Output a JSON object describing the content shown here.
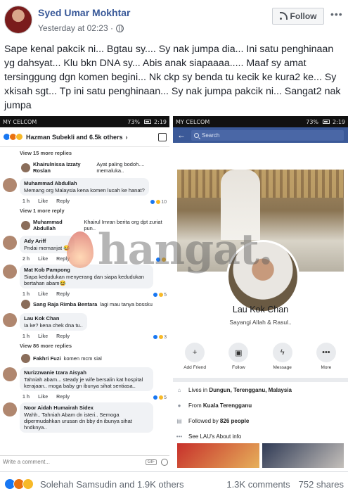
{
  "post": {
    "author": "Syed Umar Mokhtar",
    "time": "Yesterday at 02:23 · ",
    "follow_label": "Follow",
    "text": "Sape kenal pakcik ni... Bgtau sy.... Sy nak jumpa dia... Ini satu penghinaan yg dahsyat... Klu bkn DNA sy... Abis anak siapaaaa..... Maaf sy amat tersinggung dgn komen begini... Nk ckp sy benda tu kecik ke kura2 ke... Sy xkisah sgt... Tp ini satu penghinaan... Sy nak jumpa pakcik ni... Sangat2 nak jumpa"
  },
  "left_screen": {
    "carrier": "MY CELCOM",
    "battery": "73%",
    "clock": "2:19",
    "reacted_by": "Hazman Subekli and 6.5k others",
    "items": [
      {
        "kind": "more",
        "text": "View 15 more replies"
      },
      {
        "kind": "reply",
        "name": "Khairulnissa Izzaty Roslan",
        "text": "Ayat paling bodoh.... memaluka.."
      },
      {
        "kind": "comment",
        "name": "Muhammad Abdullah",
        "text": "Memang org Malaysia kena komen lucah ke hanat?",
        "time": "1 h",
        "count": "10"
      },
      {
        "kind": "more",
        "text": "View 1 more reply"
      },
      {
        "kind": "reply",
        "name": "Muhammad Abdullah",
        "text": "Khairul Imran berita org dpt zuriat pun.."
      },
      {
        "kind": "comment",
        "name": "Ady Ariff",
        "text": "Pndai memanjat 😂",
        "time": "2 h",
        "count": ""
      },
      {
        "kind": "comment",
        "name": "Mat Kob Pampong",
        "text": "Siapa kedudukan menyerang dan siapa kedudukan bertahan abam😂",
        "time": "1 h",
        "count": "5"
      },
      {
        "kind": "reply",
        "name": "Sang Raja Rimba Bentara",
        "text": "lagi mau tanya bossku"
      },
      {
        "kind": "comment",
        "name": "Lau Kok Chan",
        "text": "Ia ke? kena chek dna tu..",
        "time": "1 h",
        "count": "3"
      },
      {
        "kind": "more",
        "text": "View 86 more replies"
      },
      {
        "kind": "reply",
        "name": "Fakhri Fuzi",
        "text": "komen mcm sial"
      },
      {
        "kind": "comment",
        "name": "Nurizzwanie Izara Aisyah",
        "text": "Tahniah abam... steady je wife bersalin kat hospital kerajaan.. moga baby gn ibunya sihat sentiasa..",
        "time": "1 h",
        "count": "5"
      },
      {
        "kind": "comment",
        "name": "Noor Aidah Humairah Sidex",
        "text": "Wahh.. Tahniah Abam dn isteri.. Semoga dipermudahkan urusan dn bby dn ibunya sihat hndknya..",
        "time": "",
        "count": ""
      }
    ],
    "labels": {
      "like": "Like",
      "reply": "Reply",
      "write": "Write a comment...",
      "gif": "GIF"
    }
  },
  "right_screen": {
    "carrier": "MY CELCOM",
    "battery": "73%",
    "clock": "2:19",
    "search_placeholder": "Search",
    "profile_name": "Lau Kok Chan",
    "bio": "Sayangi Allah & Rasul..",
    "actions": [
      "Add Friend",
      "Follow",
      "Message",
      "More"
    ],
    "info": [
      {
        "icon": "home-icon",
        "prefix": "Lives in ",
        "value": "Dungun, Terengganu, Malaysia"
      },
      {
        "icon": "location-icon",
        "prefix": "From ",
        "value": "Kuala Terengganu"
      },
      {
        "icon": "followers-icon",
        "prefix": "Followed by ",
        "value": "826 people"
      },
      {
        "icon": "ellipsis-icon",
        "prefix": "",
        "value": "See LAU's About info"
      }
    ]
  },
  "watermark": "hangat.",
  "footer": {
    "reactions": "Solehah Samsudin and 1.9K others",
    "comments": "1.3K comments",
    "shares": "752 shares"
  },
  "colors": {
    "fb_blue": "#3b5998",
    "link": "#385898",
    "like": "#1877f2",
    "angry": "#e9710f",
    "haha": "#f7b928"
  }
}
